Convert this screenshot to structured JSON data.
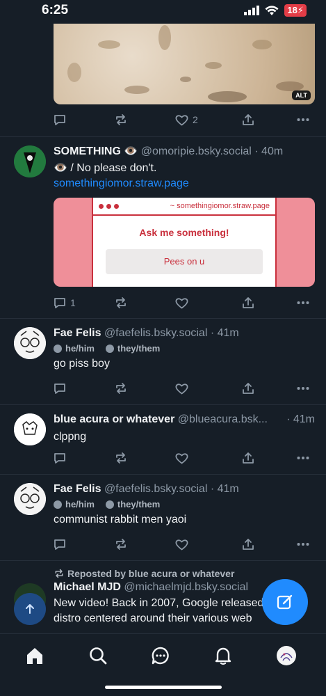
{
  "status": {
    "time": "6:25",
    "battery": "18"
  },
  "posts": [
    {
      "kind": "image-tail",
      "alt_badge": "ALT",
      "actions": {
        "reply": "",
        "repost": "",
        "like": "2"
      }
    },
    {
      "name": "SOMETHING 👁️",
      "handle": "@omoripie.bsky.social · 40m",
      "text": "👁️ / No please don't.",
      "link": "somethingiomor.straw.page",
      "card": {
        "url": "~ somethingiomor.straw.page",
        "title": "Ask me something!",
        "button": "Pees on u"
      },
      "actions": {
        "reply": "1",
        "repost": "",
        "like": ""
      }
    },
    {
      "name": "Fae Felis",
      "handle": "@faefelis.bsky.social · 41m",
      "pronouns": [
        "he/him",
        "they/them"
      ],
      "text": "go piss boy",
      "actions": {
        "reply": "",
        "repost": "",
        "like": ""
      }
    },
    {
      "name": "blue acura or whatever",
      "handle": "@blueacura.bsk...",
      "time": "· 41m",
      "text": "clppng",
      "actions": {
        "reply": "",
        "repost": "",
        "like": ""
      }
    },
    {
      "name": "Fae Felis",
      "handle": "@faefelis.bsky.social · 41m",
      "pronouns": [
        "he/him",
        "they/them"
      ],
      "text": "communist rabbit men yaoi",
      "actions": {
        "reply": "",
        "repost": "",
        "like": ""
      }
    },
    {
      "repost_label": "Reposted by blue acura or whatever",
      "name": "Michael MJD",
      "handle": "@michaelmjd.bsky.social",
      "text": "New video! Back in 2007, Google released a Linux distro centered around their various web"
    }
  ],
  "colors": {
    "bg": "#161e27",
    "accent": "#208bfe",
    "muted": "#8d99a6",
    "card_red": "#c9303d"
  }
}
